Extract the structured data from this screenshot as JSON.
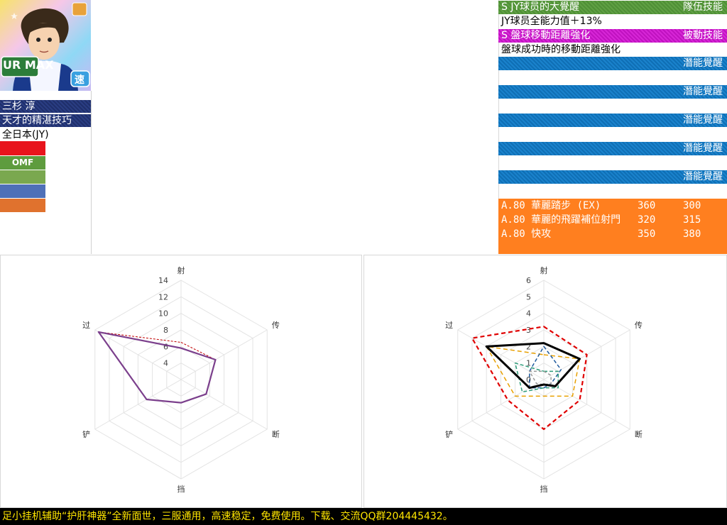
{
  "player": {
    "card_badge": "UR MAX",
    "type_badge": "速",
    "name": "三杉 淳",
    "title": "天才的精湛技巧",
    "team": "全日本(JY)",
    "position": "OMF",
    "swatch_colors": [
      "#e8141c",
      "#5e9c3e",
      "#7aa84f",
      "#4f70b8",
      "#e0722e"
    ]
  },
  "skills": {
    "rows": [
      {
        "style": "green",
        "left": "S JY球员的大覺醒",
        "right": "隊伍技能"
      },
      {
        "style": "plain",
        "left": "JY球员全能力值＋13%",
        "right": ""
      },
      {
        "style": "magenta",
        "left": "S 盤球移動距離強化",
        "right": "被動技能"
      },
      {
        "style": "plain",
        "left": "盤球成功時的移動距離強化",
        "right": ""
      },
      {
        "style": "blue",
        "left": "",
        "right": "潛能覺醒"
      },
      {
        "style": "blue",
        "left": "",
        "right": "潛能覺醒"
      },
      {
        "style": "blue",
        "left": "",
        "right": "潛能覺醒"
      },
      {
        "style": "blue",
        "left": "",
        "right": "潛能覺醒"
      },
      {
        "style": "blue",
        "left": "",
        "right": "潛能覺醒"
      }
    ],
    "actions": [
      {
        "name": "A.80 華麗踏步 (EX)",
        "v1": "360",
        "v2": "300"
      },
      {
        "name": "A.80 華麗的飛躍補位射門",
        "v1": "320",
        "v2": "315"
      },
      {
        "name": "A.80 快攻",
        "v1": "350",
        "v2": "380"
      }
    ]
  },
  "chart_data": [
    {
      "type": "radar",
      "axes": [
        "射",
        "传",
        "断",
        "挡",
        "铲",
        "过"
      ],
      "rmin": 2,
      "rmax": 14,
      "ticks": [
        4,
        6,
        8,
        10,
        12,
        14
      ],
      "series": [
        {
          "values": [
            6.5,
            6.8,
            5.5,
            4.8,
            6.8,
            13.5
          ],
          "color": "#c00000",
          "dash": "3,2",
          "width": 1
        },
        {
          "values": [
            5.8,
            6.8,
            5.5,
            4.8,
            6.8,
            13.5
          ],
          "color": "#7b3f8c",
          "dash": "",
          "width": 2.2
        }
      ]
    },
    {
      "type": "radar",
      "axes": [
        "射",
        "传",
        "断",
        "挡",
        "铲",
        "过"
      ],
      "rmin": 0,
      "rmax": 6,
      "ticks": [
        0,
        1,
        2,
        3,
        4,
        5,
        6
      ],
      "series": [
        {
          "values": [
            3.2,
            3.0,
            2.5,
            3.0,
            2.5,
            5.0
          ],
          "color": "#e00000",
          "dash": "6,4",
          "width": 2.2
        },
        {
          "values": [
            1.5,
            2.5,
            2.0,
            1.0,
            2.0,
            4.0
          ],
          "color": "#e8a000",
          "dash": "6,4",
          "width": 1.5
        },
        {
          "values": [
            2.0,
            1.2,
            0.5,
            0.5,
            1.0,
            1.0
          ],
          "color": "#1f5a9e",
          "dash": "5,3",
          "width": 1.5
        },
        {
          "values": [
            0.5,
            1.0,
            1.0,
            0.5,
            1.5,
            2.0
          ],
          "color": "#2d9c7a",
          "dash": "5,3",
          "width": 1.5
        },
        {
          "values": [
            0.5,
            0.5,
            0.5,
            0.3,
            0.5,
            1.0
          ],
          "color": "#999999",
          "dash": "4,3",
          "width": 1.5
        },
        {
          "values": [
            2.2,
            2.5,
            0.8,
            0.3,
            1.0,
            4.0
          ],
          "color": "#000000",
          "dash": "",
          "width": 3
        }
      ]
    }
  ],
  "footer": {
    "text": "足小挂机辅助“护肝神器”全新面世，三服通用，高速稳定，免费使用。下载、交流QQ群204445432。"
  }
}
